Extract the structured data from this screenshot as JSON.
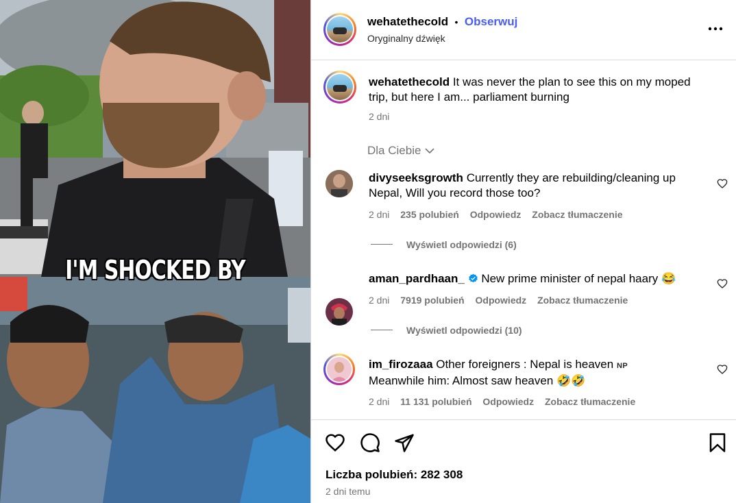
{
  "video": {
    "overlay_text": "I'M SHOCKED BY"
  },
  "header": {
    "username": "wehatethecold",
    "separator": "•",
    "follow_label": "Obserwuj",
    "audio": "Oryginalny dźwięk",
    "more_icon": "more-horizontal-icon"
  },
  "caption": {
    "username": "wehatethecold",
    "text": "It was never the plan to see this on my moped trip, but here I am... parliament burning",
    "time": "2 dni"
  },
  "sort": {
    "label": "Dla Ciebie"
  },
  "comments": [
    {
      "username": "divyseeksgrowth",
      "text": "Currently they are rebuilding/cleaning up Nepal, Will you record those too?",
      "time": "2 dni",
      "likes": "235 polubień",
      "reply": "Odpowiedz",
      "translate": "Zobacz tłumaczenie",
      "view_replies": "Wyświetl odpowiedzi (6)"
    },
    {
      "username": "aman_pardhaan_",
      "verified": true,
      "text": "New prime minister of nepal haary 😂",
      "time": "2 dni",
      "likes": "7919 polubień",
      "reply": "Odpowiedz",
      "translate": "Zobacz tłumaczenie",
      "view_replies": "Wyświetl odpowiedzi (10)"
    },
    {
      "username": "im_firozaaa",
      "text": "Other foreigners : Nepal is heaven",
      "flag": "NP",
      "text2": "Meanwhile him: Almost saw heaven 🤣🤣",
      "time": "2 dni",
      "likes": "11 131 polubień",
      "reply": "Odpowiedz",
      "translate": "Zobacz tłumaczenie"
    }
  ],
  "footer": {
    "likes_label": "Liczba polubień: 282 308",
    "time": "2 dni temu"
  },
  "colors": {
    "accent": "#4a5df9",
    "muted": "#737373",
    "verified": "#0095f6"
  }
}
